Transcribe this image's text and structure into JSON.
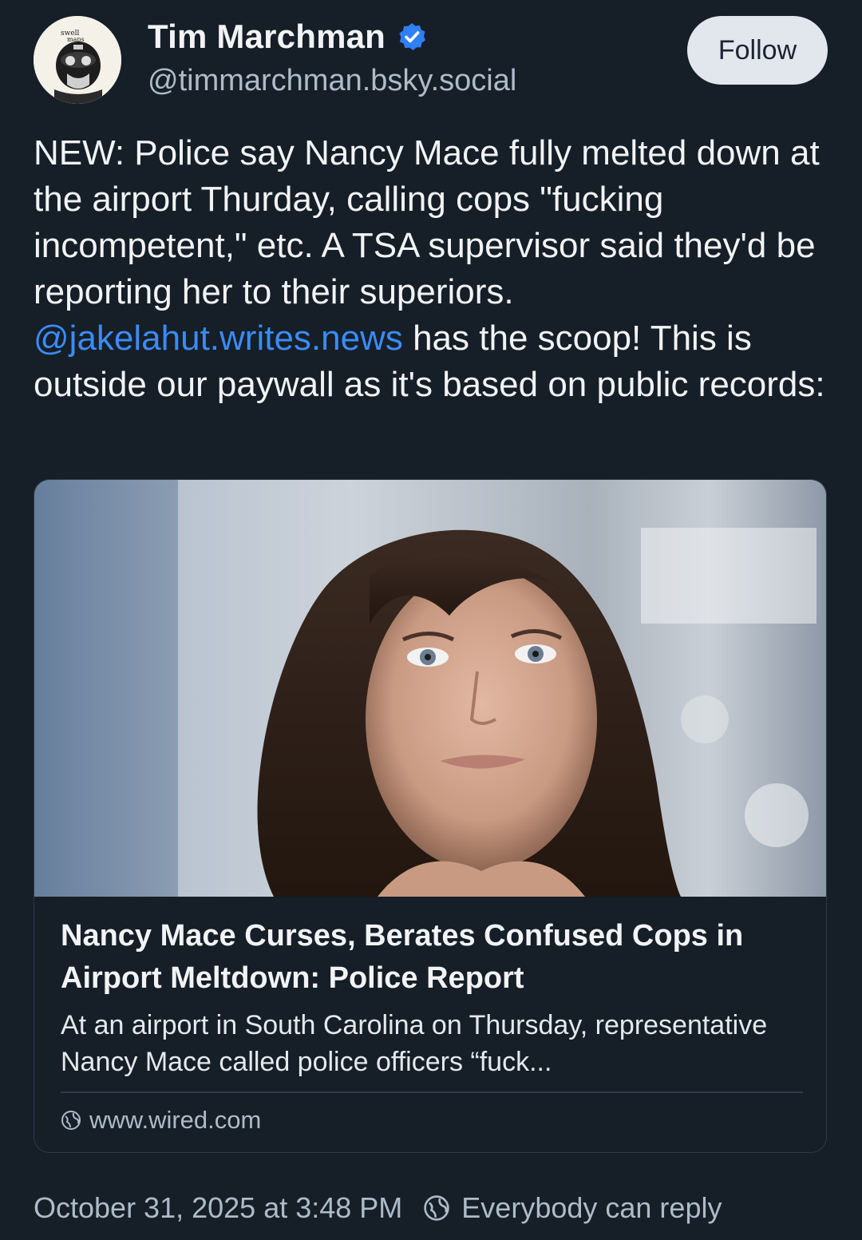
{
  "author": {
    "display_name": "Tim Marchman",
    "handle": "@timmarchman.bsky.social",
    "avatar_text": "swell maps",
    "verified_icon": "verified-check-icon"
  },
  "follow_label": "Follow",
  "post": {
    "text_1": "NEW: Police say Nancy Mace fully melted down at the airport Thurday, calling cops \"fucking incompetent,\" etc. A TSA supervisor said they'd be reporting her to their superiors. ",
    "mention": "@jakelahut.writes.news",
    "text_2": " has the scoop! This is outside our paywall as it's based on public records:"
  },
  "link_card": {
    "title": "Nancy Mace Curses, Berates Confused Cops in Airport Meltdown: Police Report",
    "description": "At an airport in South Carolina on Thursday, representative Nancy Mace called police officers “fuck...",
    "domain": "www.wired.com",
    "domain_icon": "globe-icon"
  },
  "footer": {
    "timestamp": "October 31, 2025 at 3:48 PM",
    "reply_setting": "Everybody can reply",
    "reply_icon": "globe-icon"
  },
  "colors": {
    "background": "#161e27",
    "accent": "#3b8bf6",
    "muted": "#aebbc9"
  }
}
